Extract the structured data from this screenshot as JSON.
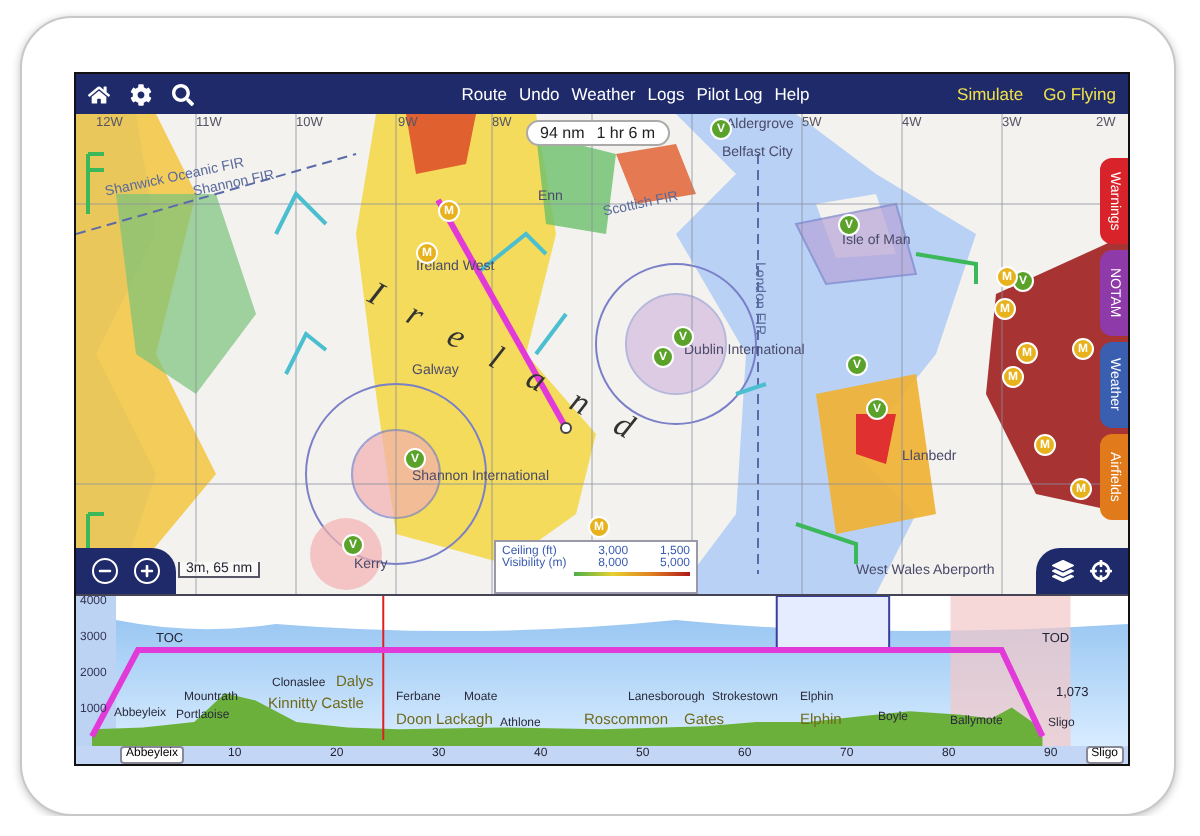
{
  "toolbar": {
    "menu": [
      "Route",
      "Undo",
      "Weather",
      "Logs",
      "Pilot Log",
      "Help"
    ],
    "actions": [
      "Simulate",
      "Go Flying"
    ]
  },
  "map": {
    "route_pill": {
      "distance": "94 nm",
      "time": "1 hr 6 m"
    },
    "longitudes": [
      "12W",
      "11W",
      "10W",
      "9W",
      "8W",
      "5W",
      "4W",
      "3W",
      "2W"
    ],
    "labels": [
      {
        "text": "Aldergrove",
        "kind": "airport"
      },
      {
        "text": "Belfast City",
        "kind": "airport"
      },
      {
        "text": "Shanwick Oceanic FIR",
        "kind": "fir"
      },
      {
        "text": "Shannon FIR",
        "kind": "fir"
      },
      {
        "text": "Enn",
        "kind": "airport"
      },
      {
        "text": "Scottish FIR",
        "kind": "fir"
      },
      {
        "text": "Ireland West",
        "kind": "airport"
      },
      {
        "text": "Isle of Man",
        "kind": "airport"
      },
      {
        "text": "London FIR",
        "kind": "fir_vertical"
      },
      {
        "text": "Dublin International",
        "kind": "airport"
      },
      {
        "text": "Galway",
        "kind": "airport"
      },
      {
        "text": "Shannon International",
        "kind": "airport"
      },
      {
        "text": "Kerry",
        "kind": "airport"
      },
      {
        "text": "Llanbedr",
        "kind": "airport"
      },
      {
        "text": "West Wales Aberporth",
        "kind": "airport"
      },
      {
        "text": "I r e l a n d",
        "kind": "country"
      }
    ],
    "markers": [
      {
        "kind": "vfr",
        "text": "V"
      },
      {
        "kind": "vfr",
        "text": "V"
      },
      {
        "kind": "vfr",
        "text": "V"
      },
      {
        "kind": "vfr",
        "text": "V"
      },
      {
        "kind": "vfr",
        "text": "V"
      },
      {
        "kind": "vfr",
        "text": "V"
      },
      {
        "kind": "vfr",
        "text": "V"
      },
      {
        "kind": "vfr",
        "text": "V"
      },
      {
        "kind": "vfr",
        "text": "V"
      },
      {
        "kind": "metar",
        "text": "M"
      },
      {
        "kind": "metar",
        "text": "M"
      },
      {
        "kind": "metar",
        "text": "M"
      },
      {
        "kind": "metar",
        "text": "M"
      },
      {
        "kind": "metar",
        "text": "M"
      },
      {
        "kind": "metar",
        "text": "M"
      },
      {
        "kind": "metar",
        "text": "M"
      },
      {
        "kind": "metar",
        "text": "M"
      },
      {
        "kind": "metar",
        "text": "M"
      },
      {
        "kind": "metar",
        "text": "M"
      }
    ],
    "scale": "3m, 65 nm",
    "legend": {
      "rows": [
        {
          "label": "Ceiling (ft)",
          "values": [
            "3,000",
            "1,500"
          ]
        },
        {
          "label": "Visibility (m)",
          "values": [
            "8,000",
            "5,000"
          ]
        }
      ]
    },
    "side_tabs": [
      {
        "label": "Warnings",
        "color": "#d8232a"
      },
      {
        "label": "NOTAM",
        "color": "#8e3aa8"
      },
      {
        "label": "Weather",
        "color": "#3a5fb0"
      },
      {
        "label": "Airfields",
        "color": "#e07a1a"
      }
    ]
  },
  "profile": {
    "y_ticks": [
      "4000",
      "3000",
      "2000",
      "1000"
    ],
    "x_ticks": [
      "10",
      "20",
      "30",
      "40",
      "50",
      "60",
      "70",
      "80",
      "90"
    ],
    "markers": [
      "TOC",
      "TOD",
      "1,073"
    ],
    "places": [
      {
        "text": "Abbeyleix",
        "kind": "small"
      },
      {
        "text": "Mountrath",
        "kind": "small"
      },
      {
        "text": "Portlaoise",
        "kind": "small"
      },
      {
        "text": "Clonaslee",
        "kind": "small"
      },
      {
        "text": "Dalys",
        "kind": "large"
      },
      {
        "text": "Kinnitty Castle",
        "kind": "large"
      },
      {
        "text": "Ferbane",
        "kind": "small"
      },
      {
        "text": "Moate",
        "kind": "small"
      },
      {
        "text": "Doon Lackagh",
        "kind": "large"
      },
      {
        "text": "Athlone",
        "kind": "small"
      },
      {
        "text": "Lanesborough",
        "kind": "small"
      },
      {
        "text": "Strokestown",
        "kind": "small"
      },
      {
        "text": "Roscommon",
        "kind": "large"
      },
      {
        "text": "Gates",
        "kind": "large"
      },
      {
        "text": "Elphin",
        "kind": "small"
      },
      {
        "text": "Elphin",
        "kind": "large"
      },
      {
        "text": "Boyle",
        "kind": "small"
      },
      {
        "text": "Ballymote",
        "kind": "small"
      },
      {
        "text": "Sligo",
        "kind": "small"
      }
    ],
    "start": "Abbeyleix",
    "end": "Sligo"
  }
}
